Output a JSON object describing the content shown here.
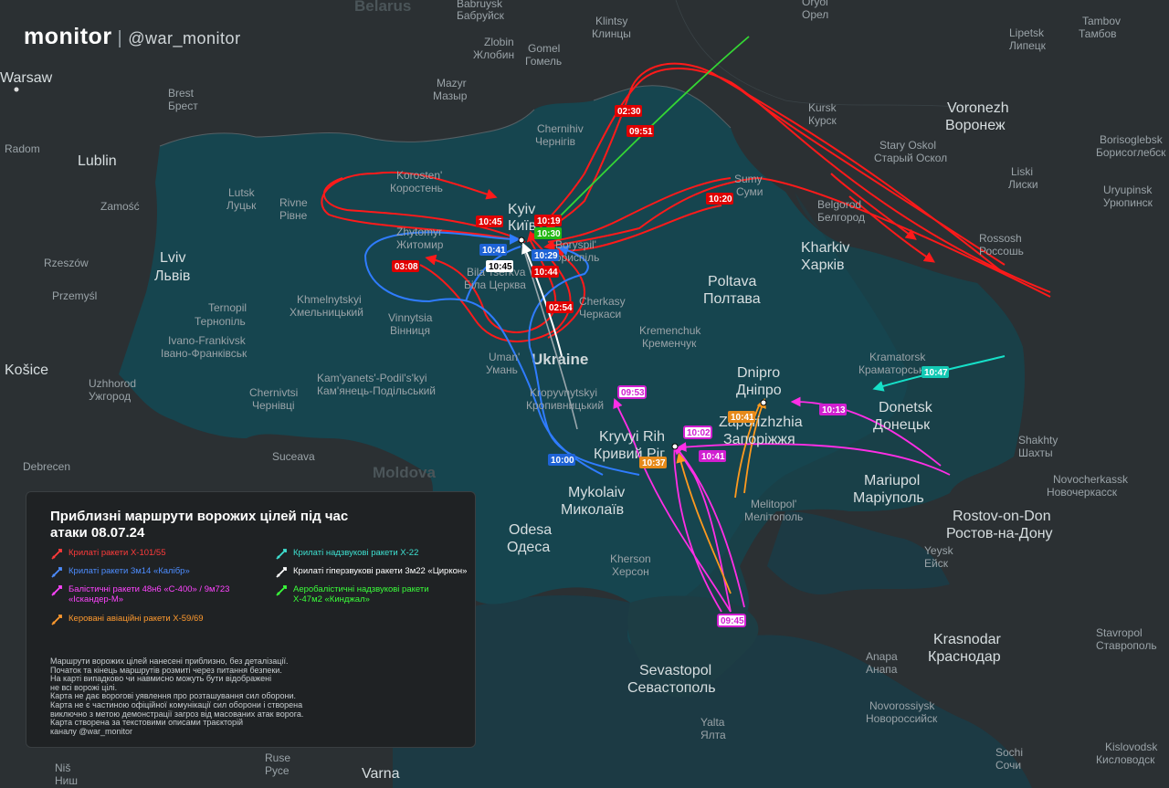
{
  "brand": {
    "name": "monitor",
    "separator": "|",
    "handle": "@war_monitor"
  },
  "map": {
    "countries": [
      "Belarus",
      "Ukraine",
      "Moldova"
    ],
    "cities": [
      {
        "id": "warsaw",
        "label": "Warsaw"
      },
      {
        "id": "brest",
        "label": "Brest",
        "label2": "Брест"
      },
      {
        "id": "radom",
        "label": "Radom"
      },
      {
        "id": "lublin",
        "label": "Lublin"
      },
      {
        "id": "zamosc",
        "label": "Zamość"
      },
      {
        "id": "rzeszow",
        "label": "Rzeszów"
      },
      {
        "id": "przemysl",
        "label": "Przemyśl"
      },
      {
        "id": "kosice",
        "label": "Košice"
      },
      {
        "id": "lviv",
        "label": "Lviv",
        "label2": "Львів"
      },
      {
        "id": "lutsk",
        "label": "Lutsk",
        "label2": "Луцьк"
      },
      {
        "id": "rivne",
        "label": "Rivne",
        "label2": "Рівне"
      },
      {
        "id": "ternopil",
        "label": "Ternopil",
        "label2": "Тернопіль"
      },
      {
        "id": "ivano",
        "label": "Ivano-Frankivsk",
        "label2": "Івано-Франківськ"
      },
      {
        "id": "uzhhorod",
        "label": "Uzhhorod",
        "label2": "Ужгород"
      },
      {
        "id": "chernivtsi",
        "label": "Chernivtsi",
        "label2": "Чернівці"
      },
      {
        "id": "khmelnytskyi",
        "label": "Khmelnytskyi",
        "label2": "Хмельницький"
      },
      {
        "id": "kamianets",
        "label": "Kam'yanets'-Podil's'kyi",
        "label2": "Кам'янець-Подільський"
      },
      {
        "id": "vinnytsia",
        "label": "Vinnytsia",
        "label2": "Вінниця"
      },
      {
        "id": "zhytomyr",
        "label": "Zhytomyr",
        "label2": "Житомир"
      },
      {
        "id": "korosten",
        "label": "Korosten'",
        "label2": "Коростень"
      },
      {
        "id": "kyiv",
        "label": "Kyiv",
        "label2": "Київ"
      },
      {
        "id": "boryspil",
        "label": "Boryspil'",
        "label2": "Бориспіль"
      },
      {
        "id": "bila",
        "label": "Bila Tserkva",
        "label2": "Біла Церква"
      },
      {
        "id": "uman",
        "label": "Uman'",
        "label2": "Умань"
      },
      {
        "id": "cherkasy",
        "label": "Cherkasy",
        "label2": "Черкаси"
      },
      {
        "id": "chernihiv",
        "label": "Chernihiv",
        "label2": "Чернігів"
      },
      {
        "id": "mazyr",
        "label": "Mazyr",
        "label2": "Мазыр"
      },
      {
        "id": "zlobin",
        "label": "Zlobin",
        "label2": "Жлобин"
      },
      {
        "id": "gomel",
        "label": "Gomel",
        "label2": "Гомель"
      },
      {
        "id": "babruysk",
        "label": "Babruysk",
        "label2": "Бабруйск"
      },
      {
        "id": "klintsy",
        "label": "Klintsy",
        "label2": "Клинцы"
      },
      {
        "id": "orel",
        "label": "Oryol",
        "label2": "Орел"
      },
      {
        "id": "lipetsk",
        "label": "Lipetsk",
        "label2": "Липецк"
      },
      {
        "id": "tambov",
        "label": "Tambov",
        "label2": "Тамбов"
      },
      {
        "id": "kursk",
        "label": "Kursk",
        "label2": "Курск"
      },
      {
        "id": "voronezh",
        "label": "Voronezh",
        "label2": "Воронеж"
      },
      {
        "id": "staryoskol",
        "label": "Stary Oskol",
        "label2": "Старый Оскол"
      },
      {
        "id": "borisoglebsk",
        "label": "Borisoglebsk",
        "label2": "Борисоглебск"
      },
      {
        "id": "liski",
        "label": "Liski",
        "label2": "Лиски"
      },
      {
        "id": "uryupinsk",
        "label": "Uryupinsk",
        "label2": "Урюпинск"
      },
      {
        "id": "sumy",
        "label": "Sumy",
        "label2": "Суми"
      },
      {
        "id": "belgorod",
        "label": "Belgorod",
        "label2": "Белгород"
      },
      {
        "id": "rossosh",
        "label": "Rossosh",
        "label2": "Россошь"
      },
      {
        "id": "kharkiv",
        "label": "Kharkiv",
        "label2": "Харків"
      },
      {
        "id": "poltava",
        "label": "Poltava",
        "label2": "Полтава"
      },
      {
        "id": "kremenchuk",
        "label": "Kremenchuk",
        "label2": "Кременчук"
      },
      {
        "id": "kropyvnytskyi",
        "label": "Kropyvnytskyi",
        "label2": "Кропивницький"
      },
      {
        "id": "dnipro",
        "label": "Dnipro",
        "label2": "Дніпро"
      },
      {
        "id": "kramatorsk",
        "label": "Kramatorsk",
        "label2": "Краматорськ"
      },
      {
        "id": "donetsk",
        "label": "Donetsk",
        "label2": "Донецьк"
      },
      {
        "id": "kryvyi",
        "label": "Kryvyi Rih",
        "label2": "Кривий Ріг"
      },
      {
        "id": "zaporizhzhia",
        "label": "Zaporizhzhia",
        "label2": "Запоріжжя"
      },
      {
        "id": "shakhty",
        "label": "Shakhty",
        "label2": "Шахты"
      },
      {
        "id": "novocherkassk",
        "label": "Novocherkassk",
        "label2": "Новочеркасск"
      },
      {
        "id": "mariupol",
        "label": "Mariupol",
        "label2": "Маріуполь"
      },
      {
        "id": "rostov",
        "label": "Rostov-on-Don",
        "label2": "Ростов-на-Дону"
      },
      {
        "id": "yeysk",
        "label": "Yeysk",
        "label2": "Ейск"
      },
      {
        "id": "melitopol",
        "label": "Melitopol'",
        "label2": "Мелітополь"
      },
      {
        "id": "mykolaiv",
        "label": "Mykolaiv",
        "label2": "Миколаїв"
      },
      {
        "id": "odesa",
        "label": "Odesa",
        "label2": "Одеса"
      },
      {
        "id": "kherson",
        "label": "Kherson",
        "label2": "Херсон"
      },
      {
        "id": "krasnodar",
        "label": "Krasnodar",
        "label2": "Краснодар"
      },
      {
        "id": "stavropol",
        "label": "Stavropol",
        "label2": "Ставрополь"
      },
      {
        "id": "anapa",
        "label": "Anapa",
        "label2": "Анапа"
      },
      {
        "id": "novorossiysk",
        "label": "Novorossiysk",
        "label2": "Новороссийск"
      },
      {
        "id": "sevastopol",
        "label": "Sevastopol",
        "label2": "Севастополь"
      },
      {
        "id": "yalta",
        "label": "Yalta",
        "label2": "Ялта"
      },
      {
        "id": "sochi",
        "label": "Sochi",
        "label2": "Сочи"
      },
      {
        "id": "kislovodsk",
        "label": "Kislovodsk",
        "label2": "Кисловодск"
      },
      {
        "id": "suceava",
        "label": "Suceava"
      },
      {
        "id": "debrecen",
        "label": "Debrecen"
      },
      {
        "id": "varna",
        "label": "Varna"
      },
      {
        "id": "ruse",
        "label": "Ruse",
        "label2": "Русе"
      },
      {
        "id": "nis",
        "label": "Niš",
        "label2": "Ниш"
      }
    ],
    "time_labels": [
      {
        "text": "02:30",
        "color": "#e00000"
      },
      {
        "text": "09:51",
        "color": "#e00000"
      },
      {
        "text": "10:20",
        "color": "#e00000"
      },
      {
        "text": "10:45",
        "color": "#e00000"
      },
      {
        "text": "10:19",
        "color": "#e00000"
      },
      {
        "text": "10:30",
        "color": "#22b814"
      },
      {
        "text": "10:41",
        "color": "#1e63d6"
      },
      {
        "text": "10:29",
        "color": "#1e63d6"
      },
      {
        "text": "10:45",
        "color": "#ffffff"
      },
      {
        "text": "10:44",
        "color": "#e00000"
      },
      {
        "text": "03:08",
        "color": "#e00000"
      },
      {
        "text": "02:54",
        "color": "#e00000"
      },
      {
        "text": "09:53",
        "color": "#d11fd1"
      },
      {
        "text": "10:02",
        "color": "#d11fd1"
      },
      {
        "text": "10:41",
        "color": "#d11fd1"
      },
      {
        "text": "10:37",
        "color": "#e68a1a"
      },
      {
        "text": "10:41",
        "color": "#e68a1a"
      },
      {
        "text": "10:13",
        "color": "#d11fd1"
      },
      {
        "text": "10:47",
        "color": "#13c9b4"
      },
      {
        "text": "10:00",
        "color": "#1e63d6"
      },
      {
        "text": "09:45",
        "color": "#d11fd1"
      }
    ]
  },
  "legend": {
    "title": "Приблизні маршрути ворожих цілей під час атаки 08.07.24",
    "items": [
      {
        "text": "Крилаті ракети Х-101/55",
        "color": "#ff3b3b"
      },
      {
        "text": "Крилаті надзвукові ракети Х-22",
        "color": "#3ee0d0"
      },
      {
        "text": "Крилаті ракети 3м14 «Калібр»",
        "color": "#4d8dff"
      },
      {
        "text": "Крилаті гіперзвукові ракети 3м22 «Циркон»",
        "color": "#ffffff"
      },
      {
        "text": "Балістичні ракети 48н6 «С-400» / 9м723 «Іскандер-М»",
        "color": "#ff44ff"
      },
      {
        "text": "Аеробалістичні надзвукові ракети Х-47м2 «Кинджал»",
        "color": "#3aff3a"
      },
      {
        "text": "Керовані авіаційні ракети Х-59/69",
        "color": "#ff9a2e"
      }
    ],
    "note": "Маршрути ворожих цілей нанесені приблизно, без деталізації.\nПочаток та кінець маршрутів розмиті через питання безпеки.\nНа карті випадково чи навмисно можуть бути відображені\nне всі ворожі цілі.\nКарта не дає ворогові уявлення про розташування сил оборони.\nКарта не є частиною офіційної комунікації сил оборони і створена\nвиключно з метою демонстрації загроз від масованих атак ворога.\nКарта створена за текстовими описами траєкторій\nканалу @war_monitor"
  }
}
